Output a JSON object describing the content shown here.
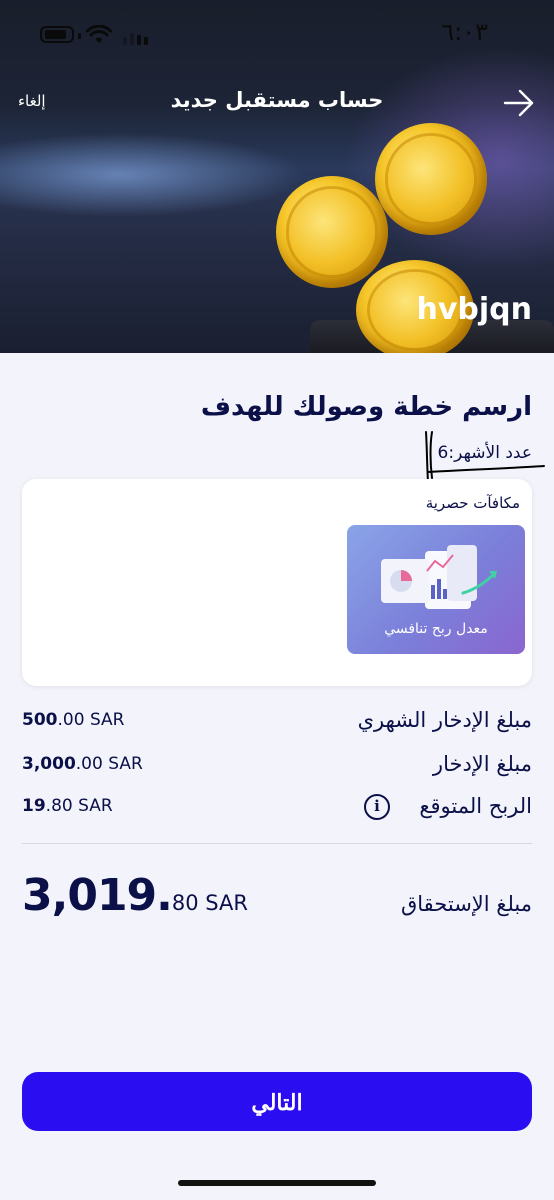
{
  "status_bar": {
    "time": "٦:٠٣"
  },
  "header": {
    "title": "حساب مستقبل جديد",
    "cancel_label": "إلغاء",
    "back_icon": "arrow-right-icon",
    "tag": "hvbjqn"
  },
  "plan": {
    "headline": "ارسم خطة وصولك للهدف",
    "months_text": "عدد الأشهر:6"
  },
  "rewards": {
    "title": "مكافآت حصرية",
    "tile_label": "معدل ربح تنافسي"
  },
  "summary": {
    "monthly_label": "مبلغ الإدخار الشهري",
    "monthly_int": "500",
    "monthly_rest": ".00 SAR",
    "saving_label": "مبلغ الإدخار",
    "saving_int": "3,000",
    "saving_rest": ".00 SAR",
    "profit_label": "الربح المتوقع",
    "profit_int": "19",
    "profit_rest": ".80 SAR",
    "total_label": "مبلغ الإستحقاق",
    "total_int": "3,019.",
    "total_rest": "80 SAR"
  },
  "actions": {
    "next_label": "التالي"
  },
  "colors": {
    "primary_button": "#2b0df2",
    "text": "#0b1048",
    "background": "#f3f4fb"
  }
}
